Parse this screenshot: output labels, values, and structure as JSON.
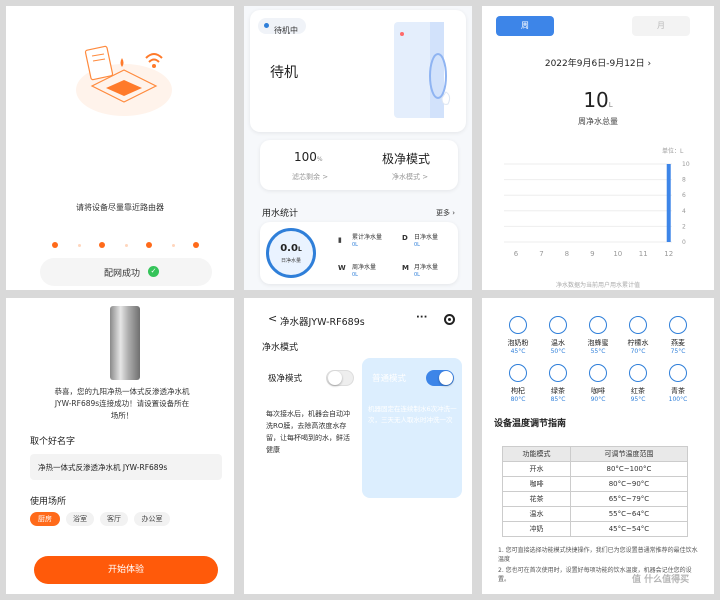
{
  "p1": {
    "prompt": "请将设备尽量靠近路由器",
    "success_btn": "配网成功"
  },
  "p2": {
    "status_badge": "待机中",
    "state": "待机",
    "filter_value": "100",
    "filter_unit": "%",
    "filter_label": "滤芯剩余 >",
    "mode_value": "极净模式",
    "mode_label": "净水模式 >",
    "stats_title": "用水统计",
    "more": "更多",
    "gauge_value": "0.0",
    "gauge_unit": "L",
    "gauge_label": "日净水量",
    "stat_total_label": "累计净水量",
    "stat_total_value": "0L",
    "stat_day_label": "日净水量",
    "stat_day_value": "0L",
    "stat_week_label": "周净水量",
    "stat_week_value": "0L",
    "stat_month_label": "月净水量",
    "stat_month_value": "0L",
    "icon_d": "D",
    "icon_w": "W",
    "icon_m": "M"
  },
  "p3": {
    "tab_week": "周",
    "tab_month": "月",
    "date_range": "2022年9月6日-9月12日",
    "total_value": "10",
    "total_unit": "L",
    "total_label": "周净水总量",
    "unit_label": "单位：L",
    "note": "净水数据为当前用户用水累计值"
  },
  "chart_data": {
    "type": "bar",
    "categories": [
      "6",
      "7",
      "8",
      "9",
      "10",
      "11",
      "12"
    ],
    "values": [
      0,
      0,
      0,
      0,
      0,
      0,
      10
    ],
    "ylabel": "单位：L",
    "yticks": [
      "0",
      "2",
      "4",
      "6",
      "8",
      "10"
    ],
    "ylim": [
      0,
      10
    ],
    "bar_color": "#3d85e8"
  },
  "p4": {
    "congrats": "恭喜，您的九阳净热一体式反渗透净水机 JYW-RF689s连接成功！请设置设备所在场所！",
    "name_title": "取个好名字",
    "name_value": "净热一体式反渗透净水机 JYW-RF689s",
    "place_title": "使用场所",
    "places": [
      "厨房",
      "浴室",
      "客厅",
      "办公室"
    ],
    "start_btn": "开始体验"
  },
  "p5": {
    "back": "<",
    "title": "净水器JYW-RF689s",
    "section": "净水模式",
    "ji_label": "极净模式",
    "ji_desc": "每次接水后，机器会自动冲洗RO膜，去除高浓度水存留，让每杯喝到的水，鲜活健康",
    "pu_label": "普通模式",
    "pu_desc": "机器固定在连续制水6次冲洗一次，三天无人取水时冲洗一次"
  },
  "p6": {
    "modes": [
      {
        "name": "泡奶粉",
        "temp": "45°C"
      },
      {
        "name": "温水",
        "temp": "50°C"
      },
      {
        "name": "泡蜂蜜",
        "temp": "55°C"
      },
      {
        "name": "柠檬水",
        "temp": "70°C"
      },
      {
        "name": "燕麦",
        "temp": "75°C"
      },
      {
        "name": "枸杞",
        "temp": "80°C"
      },
      {
        "name": "绿茶",
        "temp": "85°C"
      },
      {
        "name": "咖啡",
        "temp": "90°C"
      },
      {
        "name": "红茶",
        "temp": "95°C"
      },
      {
        "name": "青茶",
        "temp": "100°C"
      }
    ],
    "guide_title": "设备温度调节指南",
    "table_headers": [
      "功能模式",
      "可调节温度范围"
    ],
    "table_rows": [
      [
        "开水",
        "80°C~100°C"
      ],
      [
        "咖啡",
        "80°C~90°C"
      ],
      [
        "花茶",
        "65°C~79°C"
      ],
      [
        "温水",
        "55°C~64°C"
      ],
      [
        "冲奶",
        "45°C~54°C"
      ]
    ],
    "note1": "1. 您可直接选择功能模式快捷操作，我们已为您设置普通常推荐的最佳饮水温度",
    "note2": "2. 您也可在首次使用时，设置好每项功能的饮水温度，机器会记住您的设置。",
    "watermark": "值 什么值得买"
  }
}
